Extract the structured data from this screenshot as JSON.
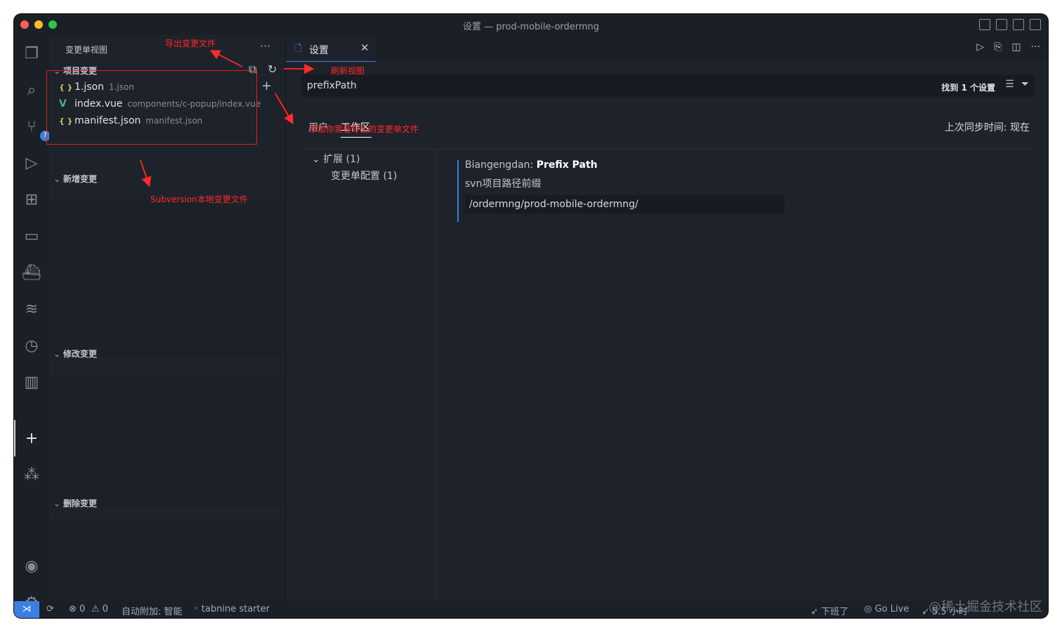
{
  "window": {
    "title": "设置 — prod-mobile-ordermng"
  },
  "activity_bar": {
    "scm_badge": "7"
  },
  "sidebar": {
    "title": "变更单视图",
    "more": "···",
    "sections": [
      {
        "label": "项目变更"
      },
      {
        "label": "新增变更"
      },
      {
        "label": "修改变更"
      },
      {
        "label": "删除变更"
      }
    ],
    "files": [
      {
        "icon": "{ }",
        "name": "1.json",
        "path": "1.json"
      },
      {
        "icon": "V",
        "name": "index.vue",
        "path": "components/c-popup/index.vue"
      },
      {
        "icon": "{ }",
        "name": "manifest.json",
        "path": "manifest.json"
      }
    ]
  },
  "editor": {
    "tab_label": "设置",
    "search": {
      "value": "prefixPath",
      "count": "找到 1 个设置"
    },
    "scopes": {
      "user": "用户",
      "workspace": "工作区"
    },
    "sync_time": "上次同步时间: 现在",
    "toc": {
      "extensions": "扩展 (1)",
      "sub": "变更单配置 (1)"
    },
    "setting": {
      "category": "Biangengdan: ",
      "name": "Prefix Path",
      "description": "svn项目路径前缀",
      "value": "/ordermng/prod-mobile-ordermng/"
    }
  },
  "statusbar": {
    "errors": "⊗ 0",
    "warnings": "⚠ 0",
    "auto_attach": "自动附加: 智能",
    "tabnine": "◦ tabnine starter",
    "off_work": "下班了",
    "go_live": "Go Live",
    "time_left": "5.5 小时",
    "watermark": "@稀土掘金技术社区"
  },
  "annotations": {
    "export": "导出变更文件",
    "refresh": "刷新视图",
    "add": "添加你需要导出的变更单文件",
    "svn": "Subversion本地变更文件"
  },
  "colors": {
    "accent": "#3b7fe0",
    "annotation": "#ff2a2a",
    "background": "#1e222a"
  }
}
